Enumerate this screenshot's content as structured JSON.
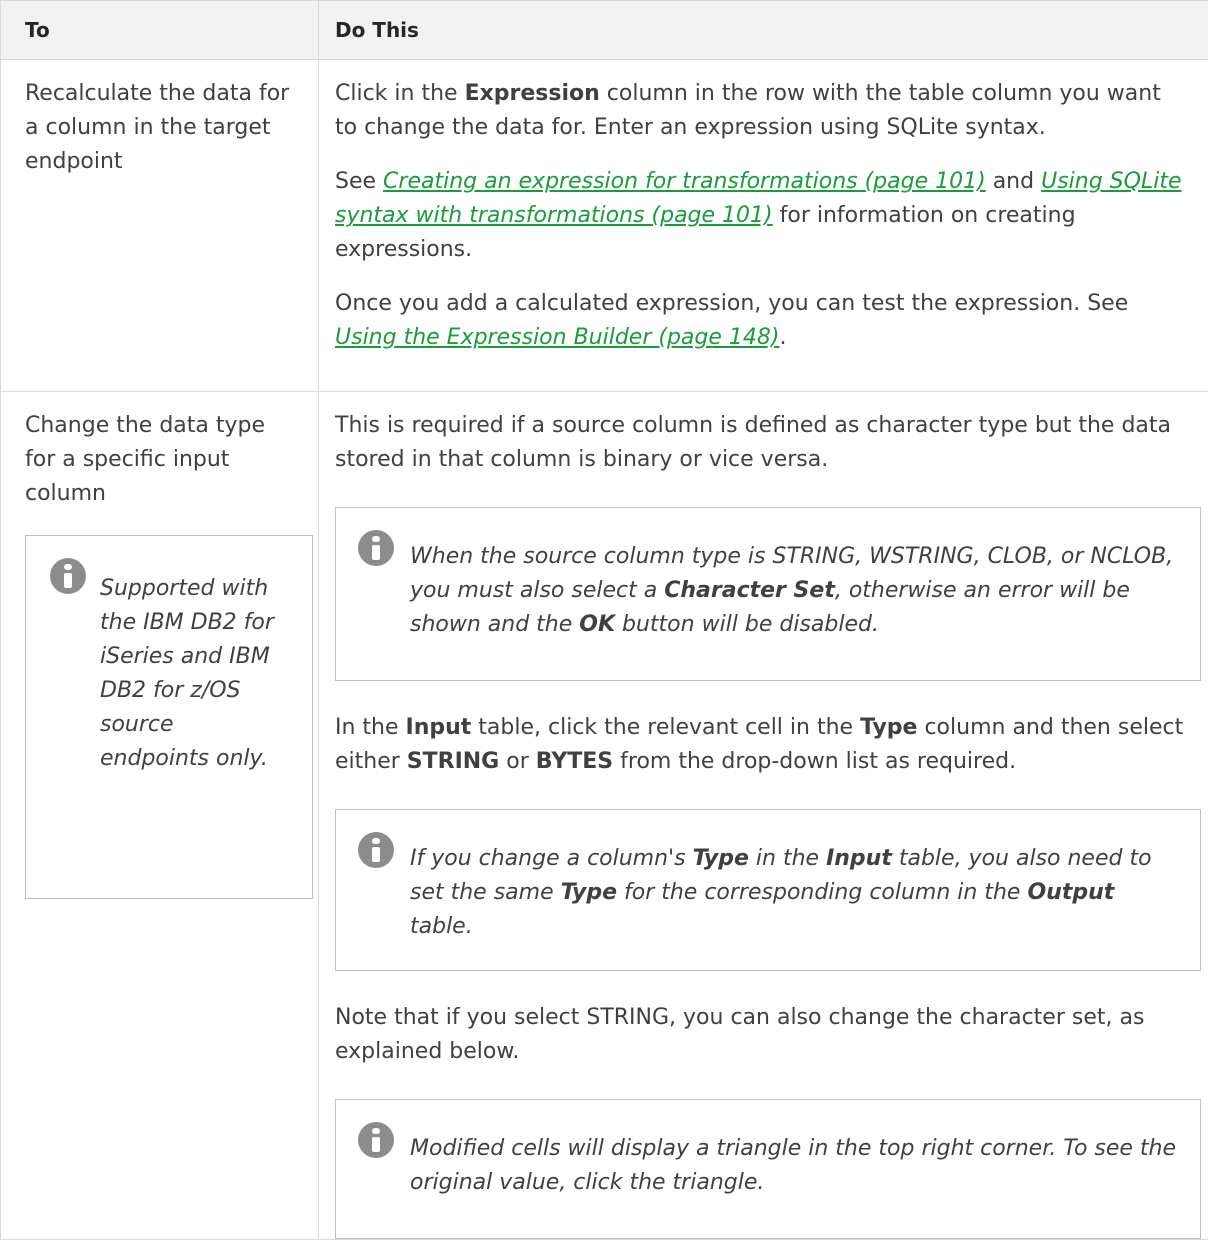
{
  "table": {
    "header": {
      "to": "To",
      "do_this": "Do This"
    },
    "row1": {
      "to": "Recalculate the data for a column in the target endpoint",
      "p1": {
        "t1": "Click in the ",
        "b1": "Expression",
        "t2": " column in the row with the table column you want to change the data for. Enter an expression using SQLite syntax."
      },
      "p2": {
        "t1": "See ",
        "link1": "Creating an expression for transformations (page 101)",
        "t2": " and ",
        "link2": "Using SQLite syntax with transformations (page 101)",
        "t3": " for information on creating expressions."
      },
      "p3": {
        "t1": "Once you add a calculated expression, you can test the expression. See ",
        "link1": "Using the Expression Builder (page 148)",
        "t2": "."
      }
    },
    "row2": {
      "to": "Change the data type for a specific input column",
      "to_note": "Supported with the IBM DB2 for iSeries and IBM DB2 for z/OS source endpoints only.",
      "p1": "This is required if a source column is defined as character type but the data stored in that column is binary or vice versa.",
      "note1": {
        "t1": "When the source column type is STRING, WSTRING, CLOB, or NCLOB, you must also select a ",
        "b1": "Character Set",
        "t2": ", otherwise an error will be shown and the ",
        "b2": "OK",
        "t3": " button will be disabled."
      },
      "p2": {
        "t1": "In the ",
        "b1": "Input",
        "t2": " table, click the relevant cell in the ",
        "b2": "Type",
        "t3": " column and then select either ",
        "b3": "STRING",
        "t4": " or ",
        "b4": "BYTES",
        "t5": " from the drop-down list as required."
      },
      "note2": {
        "t1": "If you change a column's ",
        "b1": "Type",
        "t2": " in the ",
        "b2": "Input",
        "t3": " table, you also need to set the same ",
        "b3": "Type",
        "t4": " for the corresponding column in the ",
        "b4": "Output",
        "t5": " table."
      },
      "p3": "Note that if you select STRING, you can also change the character set, as explained below.",
      "note3": "Modified cells will display a triangle in the top right corner. To see the original value, click the triangle."
    }
  },
  "icons": {
    "note_icon": "info-icon",
    "note_icon_color": "#8c8c8c"
  },
  "colors": {
    "link": "#1a9c3b",
    "header_bg": "#f2f2f2",
    "border": "#d9d9d9"
  }
}
